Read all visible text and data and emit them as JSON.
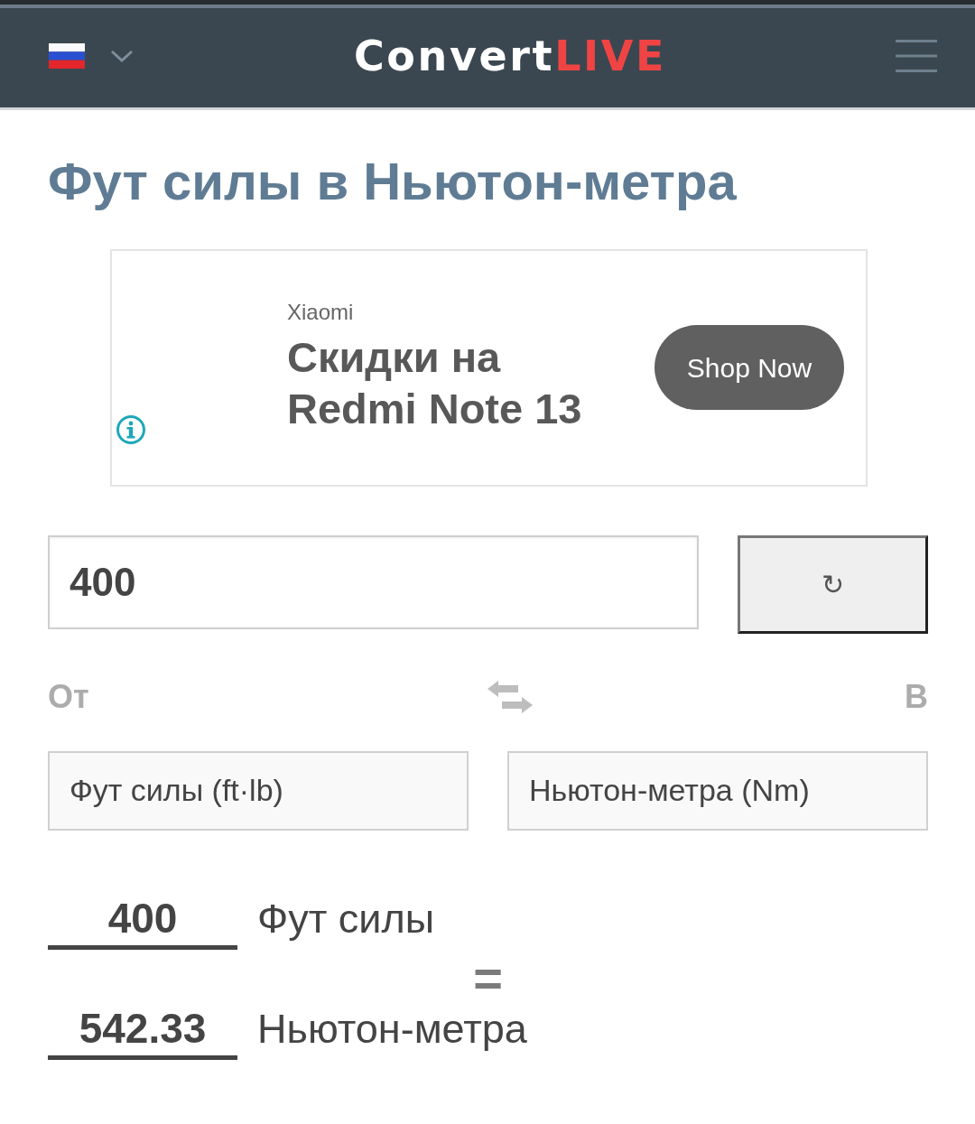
{
  "header": {
    "logo": {
      "part_1": "Convert",
      "part_2": "LIVE"
    }
  },
  "title": "Фут силы в Ньютон-метра",
  "ad": {
    "advertiser": "Xiaomi",
    "headline": "Скидки на Redmi Note 13",
    "button": "Shop Now"
  },
  "converter": {
    "input": {
      "value": "400"
    },
    "button": "↻",
    "from_label": "От",
    "to_label": "В",
    "from_unit": "Фут силы (ft·lb)",
    "to_unit": "Ньютон-метра (Nm)"
  },
  "result": {
    "rows": [
      {
        "value": "400",
        "unit": "Фут силы"
      },
      {
        "value": "542.33",
        "unit": "Ньютон-метра"
      }
    ],
    "equals": "="
  }
}
